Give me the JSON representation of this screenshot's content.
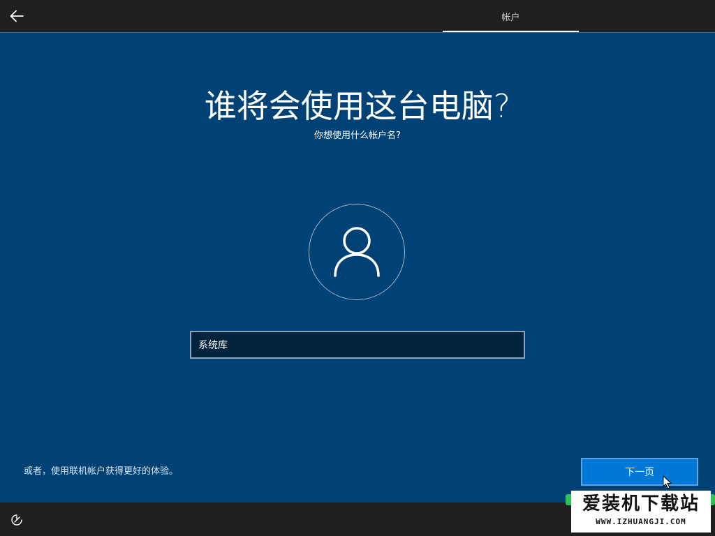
{
  "topbar": {
    "back_icon": "arrow-left-icon",
    "step_label": "帐户"
  },
  "main": {
    "title": "谁将会使用这台电脑?",
    "subtitle": "你想使用什么帐户名?",
    "avatar_icon": "user-icon",
    "name_value": "系统库"
  },
  "footer": {
    "online_account_link": "或者，使用联机帐户获得更好的体验。",
    "next_label": "下一页"
  },
  "bottombar": {
    "accessibility_icon": "ease-of-access-icon"
  },
  "watermark": {
    "main_text": "爱装机下载站",
    "url_text": "WWW.IZHUANGJI.COM"
  },
  "colors": {
    "background": "#004275",
    "bar": "#1f1f1f",
    "button": "#0078d7",
    "input_bg": "#02243f"
  }
}
